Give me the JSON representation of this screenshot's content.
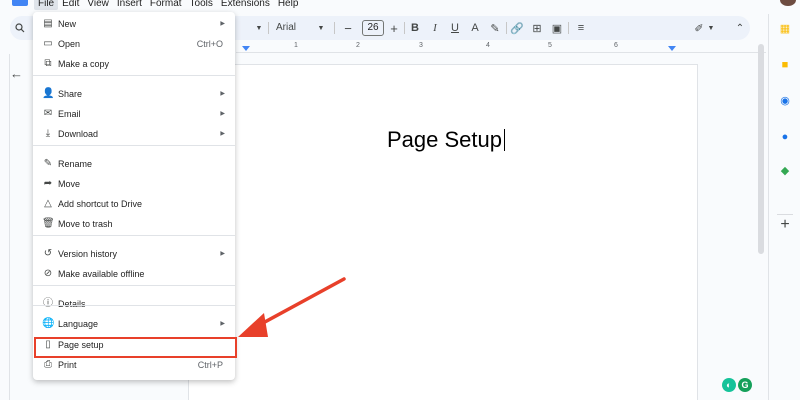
{
  "menubar": {
    "items": [
      "File",
      "Edit",
      "View",
      "Insert",
      "Format",
      "Tools",
      "Extensions",
      "Help"
    ]
  },
  "toolbar": {
    "font": "Arial",
    "font_size": "26",
    "bold": "B",
    "italic": "I",
    "underline": "U",
    "text_color": "A"
  },
  "ruler": {
    "marks": [
      "1",
      "2",
      "3",
      "4",
      "5",
      "6"
    ]
  },
  "document": {
    "title": "Page Setup"
  },
  "file_menu": {
    "items": [
      {
        "label": "New",
        "icon": "document-icon",
        "glyph": "▤",
        "shortcut": "",
        "submenu": true
      },
      {
        "label": "Open",
        "icon": "folder-icon",
        "glyph": "▭",
        "shortcut": "Ctrl+O",
        "submenu": false
      },
      {
        "label": "Make a copy",
        "icon": "copy-icon",
        "glyph": "⧉",
        "shortcut": "",
        "submenu": false
      },
      {
        "label": "Share",
        "icon": "person-add-icon",
        "glyph": "👤",
        "shortcut": "",
        "submenu": true
      },
      {
        "label": "Email",
        "icon": "email-icon",
        "glyph": "✉",
        "shortcut": "",
        "submenu": true
      },
      {
        "label": "Download",
        "icon": "download-icon",
        "glyph": "⤓",
        "shortcut": "",
        "submenu": true
      },
      {
        "label": "Rename",
        "icon": "rename-icon",
        "glyph": "✎",
        "shortcut": "",
        "submenu": false
      },
      {
        "label": "Move",
        "icon": "move-icon",
        "glyph": "➦",
        "shortcut": "",
        "submenu": false
      },
      {
        "label": "Add shortcut to Drive",
        "icon": "drive-shortcut-icon",
        "glyph": "△",
        "shortcut": "",
        "submenu": false
      },
      {
        "label": "Move to trash",
        "icon": "trash-icon",
        "glyph": "🗑",
        "shortcut": "",
        "submenu": false
      },
      {
        "label": "Version history",
        "icon": "history-icon",
        "glyph": "↺",
        "shortcut": "",
        "submenu": true
      },
      {
        "label": "Make available offline",
        "icon": "offline-icon",
        "glyph": "⊘",
        "shortcut": "",
        "submenu": false
      },
      {
        "label": "Details",
        "icon": "info-icon",
        "glyph": "ⓘ",
        "shortcut": "",
        "submenu": false
      },
      {
        "label": "Language",
        "icon": "globe-icon",
        "glyph": "🌐",
        "shortcut": "",
        "submenu": true
      },
      {
        "label": "Page setup",
        "icon": "page-setup-icon",
        "glyph": "▯",
        "shortcut": "",
        "submenu": false
      },
      {
        "label": "Print",
        "icon": "print-icon",
        "glyph": "⎙",
        "shortcut": "Ctrl+P",
        "submenu": false
      }
    ]
  },
  "colors": {
    "annotation": "#e8402a",
    "toolbar_bg": "#edf2fa",
    "accent": "#4285f4"
  }
}
